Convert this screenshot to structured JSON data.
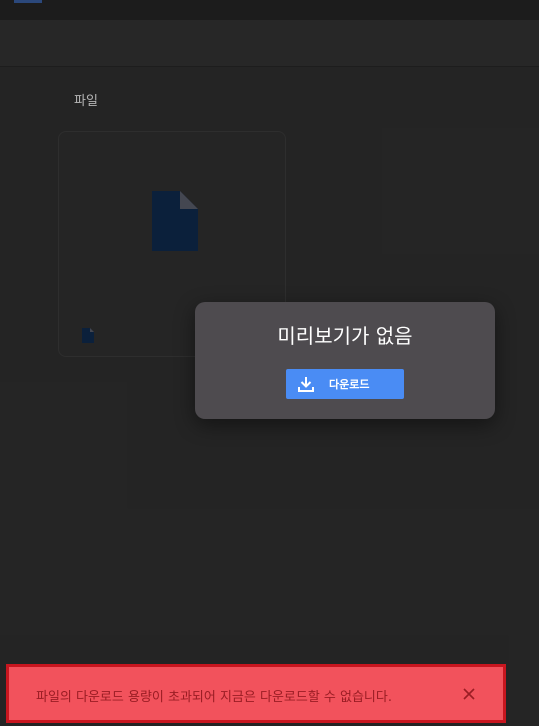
{
  "section": {
    "label": "파일"
  },
  "preview_dialog": {
    "title": "미리보기가 없음",
    "download_label": "다운로드"
  },
  "error_toast": {
    "message": "파일의 다운로드 용량이 초과되어 지금은 다운로드할 수 없습니다."
  },
  "colors": {
    "file_icon": "#0d2341",
    "accent": "#4a8cf4",
    "error_bg": "#f2525c",
    "error_border": "#c8161f"
  },
  "icons": [
    "document-icon",
    "download-icon",
    "close-icon"
  ]
}
